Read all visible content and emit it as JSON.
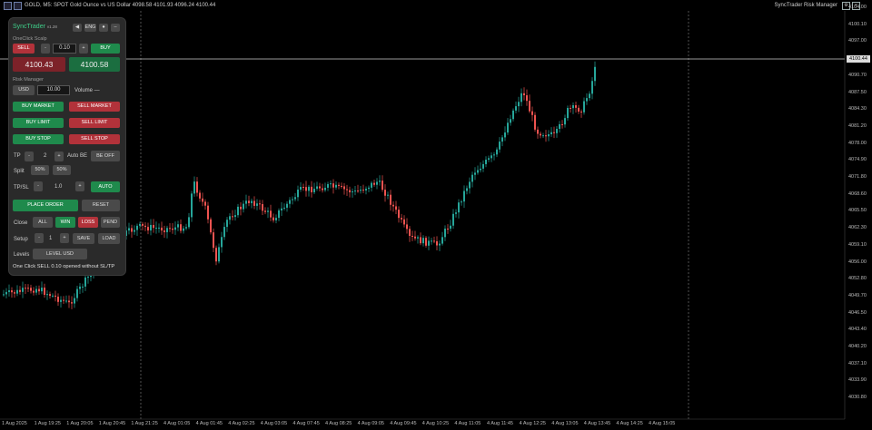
{
  "window": {
    "title": "GOLD, M5:  SPOT Gold Ounce vs US Dollar  4098.58 4101.93 4096.24 4100.44",
    "indicator_name": "SyncTrader Risk Manager"
  },
  "price_axis": [
    "4104.00",
    "4100.10",
    "4097.00",
    "4093.70",
    "4090.70",
    "4087.50",
    "4084.30",
    "4081.20",
    "4078.00",
    "4074.90",
    "4071.80",
    "4068.60",
    "4065.50",
    "4062.30",
    "4059.10",
    "4056.00",
    "4052.80",
    "4049.70",
    "4046.50",
    "4043.40",
    "4040.20",
    "4037.10",
    "4033.90",
    "4030.80"
  ],
  "current_price": "4100.44",
  "time_axis": [
    "1 Aug 2025",
    "1 Aug 19:25",
    "1 Aug 20:05",
    "1 Aug 20:45",
    "1 Aug 21:25",
    "4 Aug 01:05",
    "4 Aug 01:45",
    "4 Aug 02:25",
    "4 Aug 03:05",
    "4 Aug 07:45",
    "4 Aug 08:25",
    "4 Aug 09:05",
    "4 Aug 09:45",
    "4 Aug 10:25",
    "4 Aug 11:05",
    "4 Aug 11:45",
    "4 Aug 12:25",
    "4 Aug 13:05",
    "4 Aug 13:45",
    "4 Aug 14:25",
    "4 Aug 15:05"
  ],
  "panel": {
    "app_name": "SyncTrader",
    "version": "v1.28",
    "top_buttons": [
      "◀",
      "ENG",
      "●",
      "–"
    ],
    "oneclick_label": "OneClick Scalp",
    "sell": "SELL",
    "minus": "-",
    "lot": "0.10",
    "plus": "+",
    "buy": "BUY",
    "bid": "4100.43",
    "ask": "4100.58",
    "risk_label": "Risk Manager",
    "currency": "USD",
    "risk_value": "10.00",
    "volume_label": "Volume  —",
    "buy_market": "BUY MARKET",
    "sell_market": "SELL MARKET",
    "buy_limit": "BUY LIMIT",
    "sell_limit": "SELL LIMIT",
    "buy_stop": "BUY STOP",
    "sell_stop": "SELL STOP",
    "tp_label": "TP",
    "tp_value": "2",
    "auto_be": "Auto BE",
    "be_off": "BE OFF",
    "split_label": "Split",
    "split_1": "50%",
    "split_2": "50%",
    "tpsl_label": "TP/SL",
    "tpsl_value": "1.0",
    "auto": "AUTO",
    "place_order": "PLACE ORDER",
    "reset": "RESET",
    "close_label": "Close",
    "close_all": "ALL",
    "close_win": "WIN",
    "close_loss": "LOSS",
    "close_pend": "PEND",
    "setup_label": "Setup",
    "setup_value": "1",
    "save": "SAVE",
    "load": "LOAD",
    "levels_label": "Levels",
    "level_usd": "LEVEL USD",
    "status": "One Click SELL 0.10 opened without SL/TP"
  },
  "colors": {
    "up": "#26a69a",
    "down": "#ef5350",
    "buy": "#1f8a4c",
    "sell": "#b2323a"
  }
}
